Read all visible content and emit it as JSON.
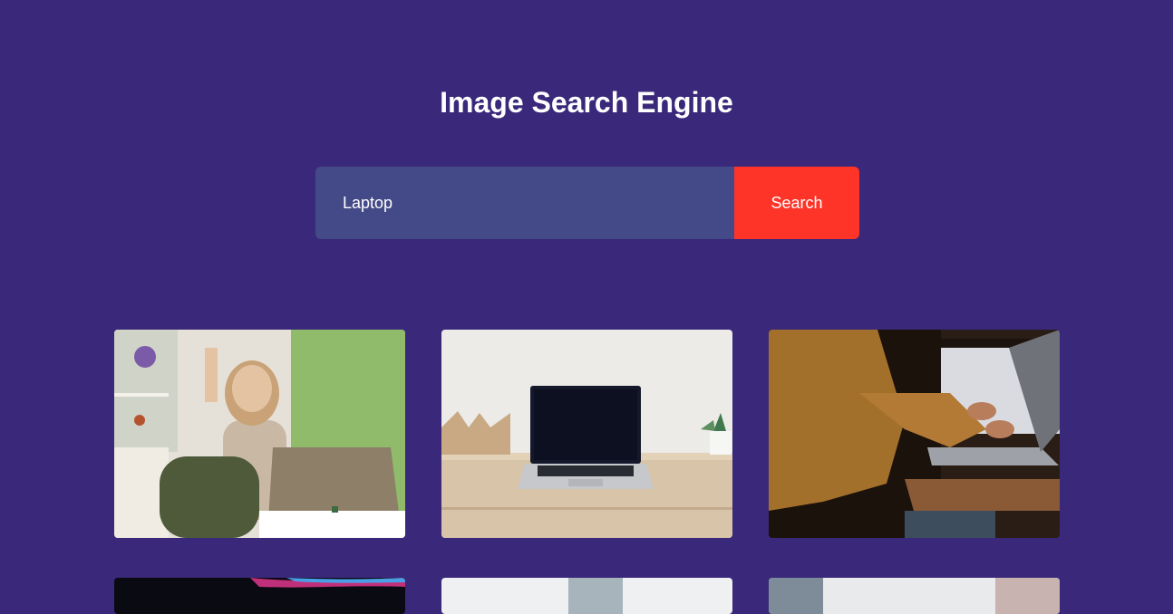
{
  "header": {
    "title": "Image Search Engine"
  },
  "search": {
    "value": "Laptop",
    "button_label": "Search"
  },
  "results": [
    {
      "subject": "woman with headphones using tablet laptop"
    },
    {
      "subject": "laptop on wooden desk"
    },
    {
      "subject": "hands typing on laptop by window"
    },
    {
      "subject": "laptop with colorful screen"
    },
    {
      "subject": "laptop photo"
    },
    {
      "subject": "laptop photo"
    }
  ],
  "colors": {
    "background": "#3a287a",
    "input_background": "#444a88",
    "button_accent": "#ff3428"
  }
}
